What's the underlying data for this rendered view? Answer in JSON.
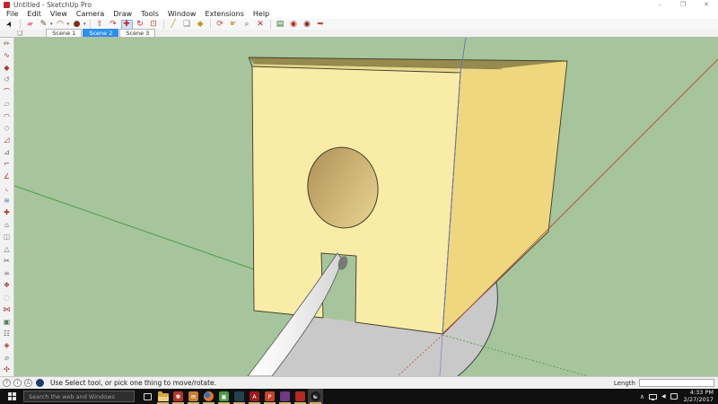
{
  "window": {
    "title": "Untitled - SketchUp Pro",
    "controls": {
      "minimize": "–",
      "maximize": "❐",
      "close": "✕"
    }
  },
  "menu": {
    "items": [
      "File",
      "Edit",
      "View",
      "Camera",
      "Draw",
      "Tools",
      "Window",
      "Extensions",
      "Help"
    ]
  },
  "toolbar": {
    "items": [
      {
        "name": "select-tool-icon",
        "glyph": "➤",
        "color": "#1a1a1a",
        "rotated": true
      },
      {
        "sep": true
      },
      {
        "name": "eraser-tool-icon",
        "glyph": "▰",
        "color": "#e08ba0"
      },
      {
        "name": "line-tool-icon",
        "glyph": "✎",
        "color": "#7a4a2a",
        "dropdown": true
      },
      {
        "name": "arc-tool-icon",
        "glyph": "◠",
        "color": "#b63a2a",
        "dropdown": true
      },
      {
        "name": "circle-tool-icon",
        "glyph": "●",
        "color": "#7a2e1d",
        "dropdown": true
      },
      {
        "sep": true
      },
      {
        "name": "push-pull-tool-icon",
        "glyph": "⇧",
        "color": "#bf3a2a"
      },
      {
        "name": "follow-me-tool-icon",
        "glyph": "↷",
        "color": "#bf3a2a"
      },
      {
        "name": "move-tool-icon",
        "glyph": "✚",
        "color": "#cc2222",
        "active": true
      },
      {
        "name": "rotate-tool-icon",
        "glyph": "↻",
        "color": "#cc2222"
      },
      {
        "name": "scale-tool-icon",
        "glyph": "⊡",
        "color": "#c0502a"
      },
      {
        "sep": true
      },
      {
        "name": "tape-measure-tool-icon",
        "glyph": "╱",
        "color": "#c09a27"
      },
      {
        "name": "dimension-tool-icon",
        "glyph": "❏",
        "color": "#777777"
      },
      {
        "name": "paint-bucket-tool-icon",
        "glyph": "◆",
        "color": "#c09a27"
      },
      {
        "sep": true
      },
      {
        "name": "orbit-tool-icon",
        "glyph": "⟳",
        "color": "#c24a3a"
      },
      {
        "name": "pan-tool-icon",
        "glyph": "☛",
        "color": "#d2a96a"
      },
      {
        "name": "zoom-tool-icon",
        "glyph": "⌕",
        "color": "#555555"
      },
      {
        "name": "zoom-extents-tool-icon",
        "glyph": "✕",
        "color": "#cc2222"
      },
      {
        "sep": true
      },
      {
        "name": "styles-panel-icon",
        "glyph": "▤",
        "color": "#3f6b3f"
      },
      {
        "name": "3d-warehouse-icon",
        "glyph": "◉",
        "color": "#a93226"
      },
      {
        "name": "extension-warehouse-icon",
        "glyph": "◉",
        "color": "#7e2a20"
      },
      {
        "name": "share-model-icon",
        "glyph": "➥",
        "color": "#bf4a3a"
      }
    ]
  },
  "scene_tabs": {
    "tabs": [
      {
        "label": "Scene 1",
        "active": false
      },
      {
        "label": "Scene 2",
        "active": true
      },
      {
        "label": "Scene 3",
        "active": false
      }
    ]
  },
  "left_toolbar": {
    "items": [
      {
        "name": "pencil-plus-icon",
        "glyph": "✏",
        "color": "#6a5a3a"
      },
      {
        "name": "curve-icon",
        "glyph": "∿",
        "color": "#a83a2e"
      },
      {
        "name": "solid-union-icon",
        "glyph": "◆",
        "color": "#a83a2e"
      },
      {
        "name": "undo-arc-icon",
        "glyph": "↺",
        "color": "#8a8a8a"
      },
      {
        "name": "arc-segment-icon",
        "glyph": "⌒",
        "color": "#a83a2e"
      },
      {
        "name": "parallelogram-icon",
        "glyph": "▱",
        "color": "#8a8a8a"
      },
      {
        "name": "dome-icon",
        "glyph": "◠",
        "color": "#a83a2e"
      },
      {
        "name": "diamond-face-icon",
        "glyph": "◇",
        "color": "#8a8a8a"
      },
      {
        "name": "wedge-icon",
        "glyph": "◿",
        "color": "#a83a2e"
      },
      {
        "name": "triangle-edge-icon",
        "glyph": "⊿",
        "color": "#555555"
      },
      {
        "name": "corner-icon",
        "glyph": "⌐",
        "color": "#a83a2e"
      },
      {
        "name": "angle-icon",
        "glyph": "∠",
        "color": "#a83a2e"
      },
      {
        "name": "fillet-icon",
        "glyph": "◟",
        "color": "#a83a2e"
      },
      {
        "name": "wave-surface-icon",
        "glyph": "≋",
        "color": "#557a9a"
      },
      {
        "name": "cross-section-icon",
        "glyph": "✚",
        "color": "#a83a2e"
      },
      {
        "name": "house-plan-icon",
        "glyph": "⌂",
        "color": "#8a8a8a"
      },
      {
        "name": "split-face-icon",
        "glyph": "◫",
        "color": "#8a8a8a"
      },
      {
        "name": "pyramid-icon",
        "glyph": "△",
        "color": "#557a5a"
      },
      {
        "name": "trim-icon",
        "glyph": "✂",
        "color": "#555555"
      },
      {
        "name": "layer-stack-icon",
        "glyph": "≡",
        "color": "#8a8a8a"
      },
      {
        "name": "vertex-tools-icon",
        "glyph": "❖",
        "color": "#a83a2e"
      },
      {
        "name": "circle-guide-icon",
        "glyph": "◌",
        "color": "#8a8a8a"
      },
      {
        "name": "bowtie-join-icon",
        "glyph": "⋈",
        "color": "#a83a2e"
      },
      {
        "name": "grid-face-icon",
        "glyph": "▣",
        "color": "#557a5a"
      },
      {
        "name": "mesh-rows-icon",
        "glyph": "☷",
        "color": "#555555"
      },
      {
        "name": "facet-gem-icon",
        "glyph": "◈",
        "color": "#a83a2e"
      },
      {
        "name": "diameter-icon",
        "glyph": "⌀",
        "color": "#8a8a8a"
      },
      {
        "name": "flower-cut-icon",
        "glyph": "✣",
        "color": "#a83a2e"
      }
    ]
  },
  "statusbar": {
    "icons": [
      {
        "name": "geolocation-icon",
        "glyph": "?"
      },
      {
        "name": "credits-icon",
        "glyph": "i"
      },
      {
        "name": "sign-in-icon",
        "glyph": "♙"
      }
    ],
    "badge_name": "sketchup-community-icon",
    "message": "Use Select tool, or pick one thing to move/rotate.",
    "length_label": "Length",
    "length_value": ""
  },
  "viewport": {
    "background_color": "#a6c59c",
    "box_front_color": "#f9eca7",
    "box_right_color": "#eed77f",
    "box_top_color": "#e9d78c",
    "axis_red": "#b25742",
    "axis_green": "#4f9a45",
    "axis_blue": "#6b79ae"
  },
  "taskbar": {
    "search_placeholder": "Search the web and Windows",
    "apps": [
      {
        "name": "task-view-icon",
        "type": "taskview",
        "underline": false
      },
      {
        "name": "file-explorer-icon",
        "type": "folder",
        "underline": true
      },
      {
        "name": "photos-app-icon",
        "type": "tile",
        "bg": "#b5342c",
        "glyph": "✽",
        "underline": true
      },
      {
        "name": "mail-app-icon",
        "type": "tile",
        "bg": "#c87f35",
        "glyph": "✉",
        "underline": true
      },
      {
        "name": "firefox-icon",
        "type": "firefox",
        "underline": true
      },
      {
        "name": "image-viewer-icon",
        "type": "tile",
        "bg": "#4f9a4a",
        "glyph": "▣",
        "underline": true
      },
      {
        "name": "photo-editor-icon",
        "type": "tile",
        "bg": "#25404e",
        "glyph": "",
        "underline": true
      },
      {
        "name": "acrobat-icon",
        "type": "tile",
        "bg": "#9b1c1c",
        "glyph": "A",
        "underline": true
      },
      {
        "name": "powerpoint-icon",
        "type": "tile",
        "bg": "#c4432b",
        "glyph": "P",
        "underline": true
      },
      {
        "name": "design-app-icon",
        "type": "tile",
        "bg": "#6f3a85",
        "glyph": "",
        "underline": true
      },
      {
        "name": "sketchup-app-icon",
        "type": "tile",
        "bg": "#b32b24",
        "glyph": "",
        "underline": true
      },
      {
        "name": "obs-icon",
        "type": "obs",
        "underline": true,
        "active": true
      }
    ],
    "tray": [
      {
        "name": "hidden-icons-chevron",
        "type": "glyph",
        "glyph": "∧",
        "cls": "caret"
      },
      {
        "name": "network-icon",
        "type": "monitor"
      },
      {
        "name": "volume-icon",
        "type": "glyph",
        "glyph": "◀",
        "cls": "speaker"
      },
      {
        "name": "notifications-icon",
        "type": "notif"
      }
    ],
    "clock": {
      "time": "4:33 PM",
      "date": "2/27/2017"
    }
  }
}
